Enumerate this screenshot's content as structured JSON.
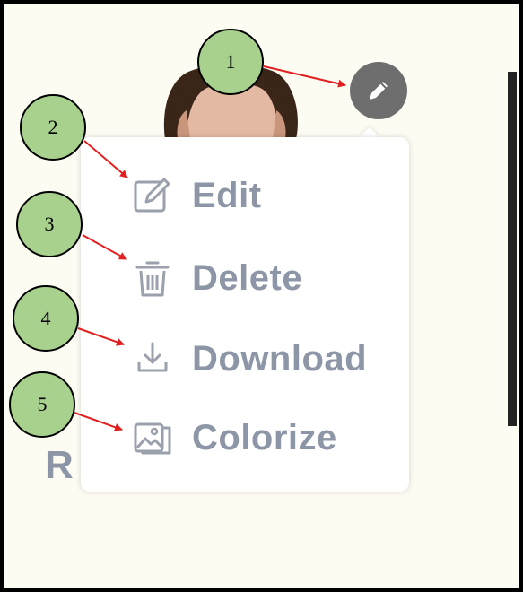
{
  "toolbar": {
    "edit_icon": "pencil-icon"
  },
  "menu": {
    "items": [
      {
        "label": "Edit",
        "icon": "edit-icon"
      },
      {
        "label": "Delete",
        "icon": "trash-icon"
      },
      {
        "label": "Download",
        "icon": "download-icon"
      },
      {
        "label": "Colorize",
        "icon": "colorize-image-icon"
      }
    ]
  },
  "background": {
    "partial_text": "R"
  },
  "annotations": {
    "callouts": [
      "1",
      "2",
      "3",
      "4",
      "5"
    ],
    "circle_color": "#a9d18e",
    "arrow_color": "#e02020"
  },
  "colors": {
    "menu_text": "#8d96a6",
    "fab": "#6e6e6e"
  }
}
